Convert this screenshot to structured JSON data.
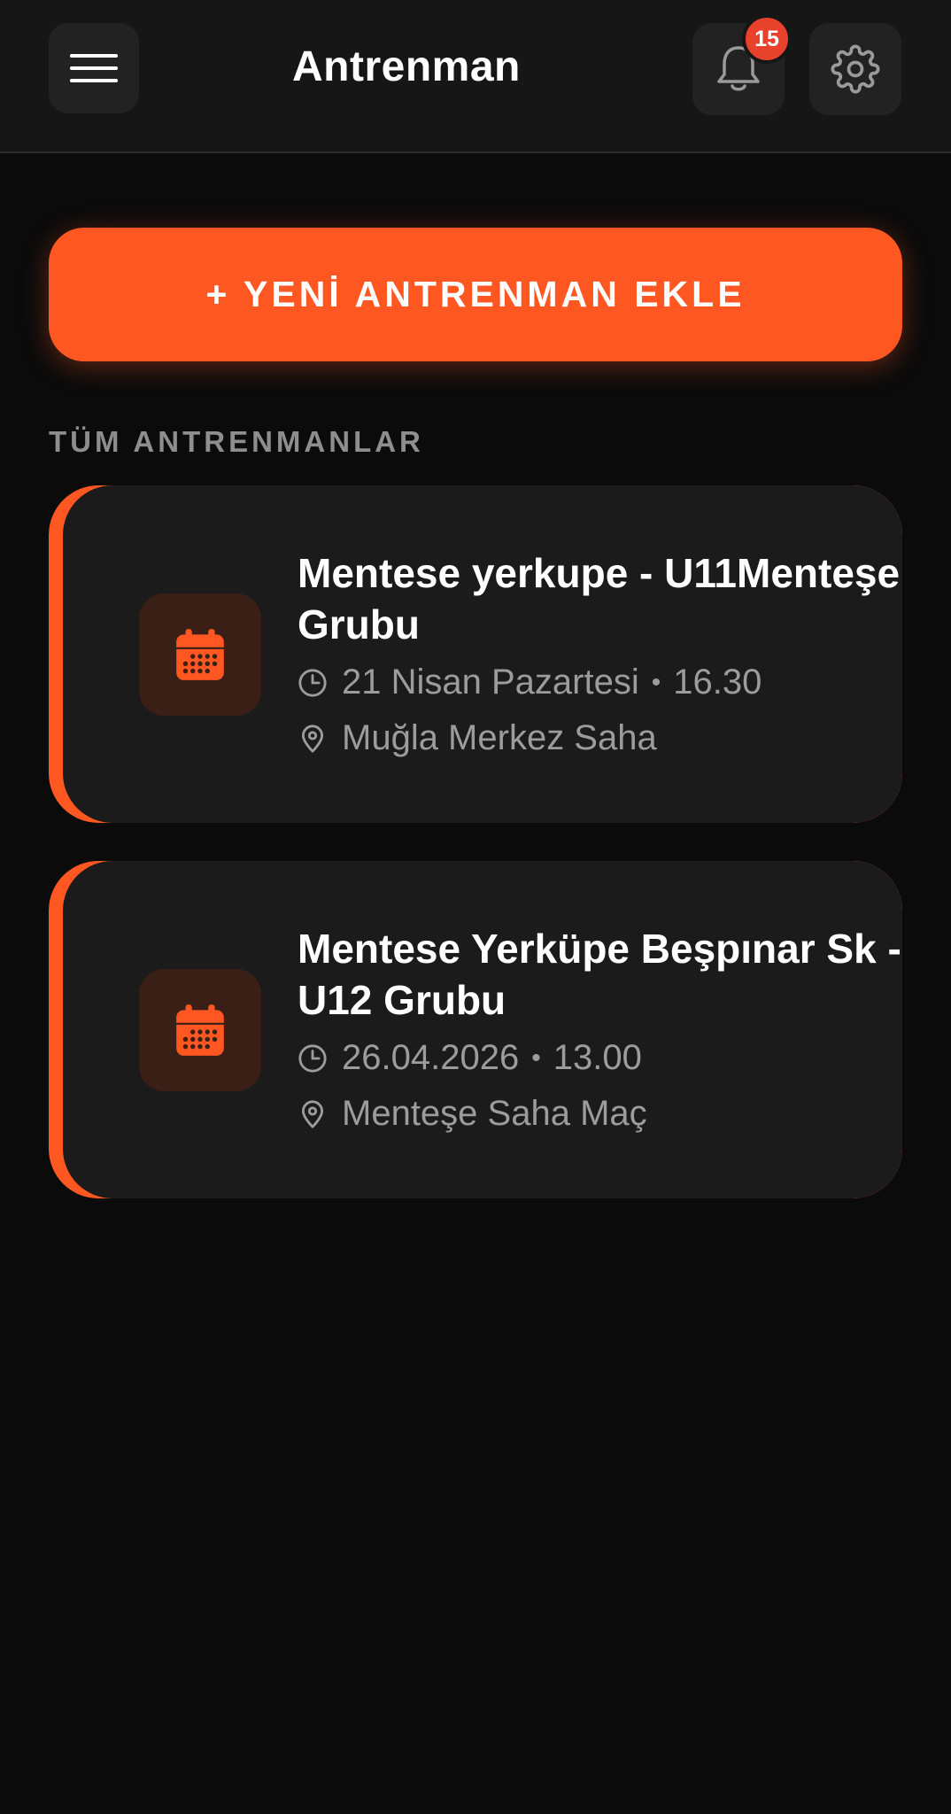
{
  "header": {
    "title": "Antrenman",
    "notification_count": "15"
  },
  "actions": {
    "add_label": "+ YENİ ANTRENMAN EKLE"
  },
  "section": {
    "label": "TÜM ANTRENMANLAR"
  },
  "trainings": [
    {
      "title": "Mentese yerkupe - U11Menteşe Grubu",
      "date": "21 Nisan Pazartesi",
      "time": "16.30",
      "location": "Muğla Merkez Saha"
    },
    {
      "title": "Mentese Yerküpe Beşpınar Sk - U12 Grubu",
      "date": "26.04.2026",
      "time": "13.00",
      "location": "Menteşe Saha Maç"
    }
  ],
  "colors": {
    "accent": "#ff5722",
    "badge": "#e8412c",
    "background": "#0b0b0b",
    "card": "#1b1b1b"
  },
  "icons": {
    "menu": "hamburger-menu-icon",
    "bell": "bell-icon",
    "gear": "gear-icon",
    "calendar": "calendar-icon",
    "clock": "clock-icon",
    "location": "location-pin-icon"
  }
}
